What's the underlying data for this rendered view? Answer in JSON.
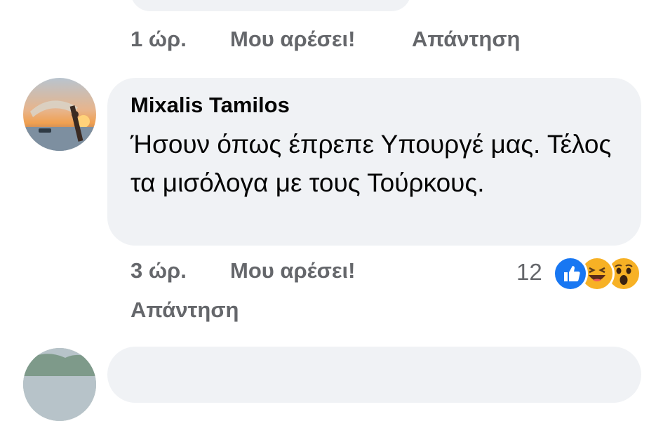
{
  "previous_comment": {
    "time": "1 ώρ.",
    "like_label": "Μου αρέσει!",
    "reply_label": "Απάντηση"
  },
  "comment": {
    "author": "Mixalis Tamilos",
    "text": "Ήσουν όπως έπρεπε Υπουργέ μας. Τέλος τα μισόλογα με τους Τούρκους.",
    "time": "3 ώρ.",
    "like_label": "Μου αρέσει!",
    "reply_label": "Απάντηση",
    "reaction_count": "12",
    "reactions": [
      "like-icon",
      "haha-icon",
      "wow-icon"
    ]
  },
  "colors": {
    "bubble": "#f0f2f5",
    "meta_text": "#65676b",
    "text": "#050505",
    "like_blue": "#1877f2",
    "emoji_yellow": "#f7b125"
  }
}
